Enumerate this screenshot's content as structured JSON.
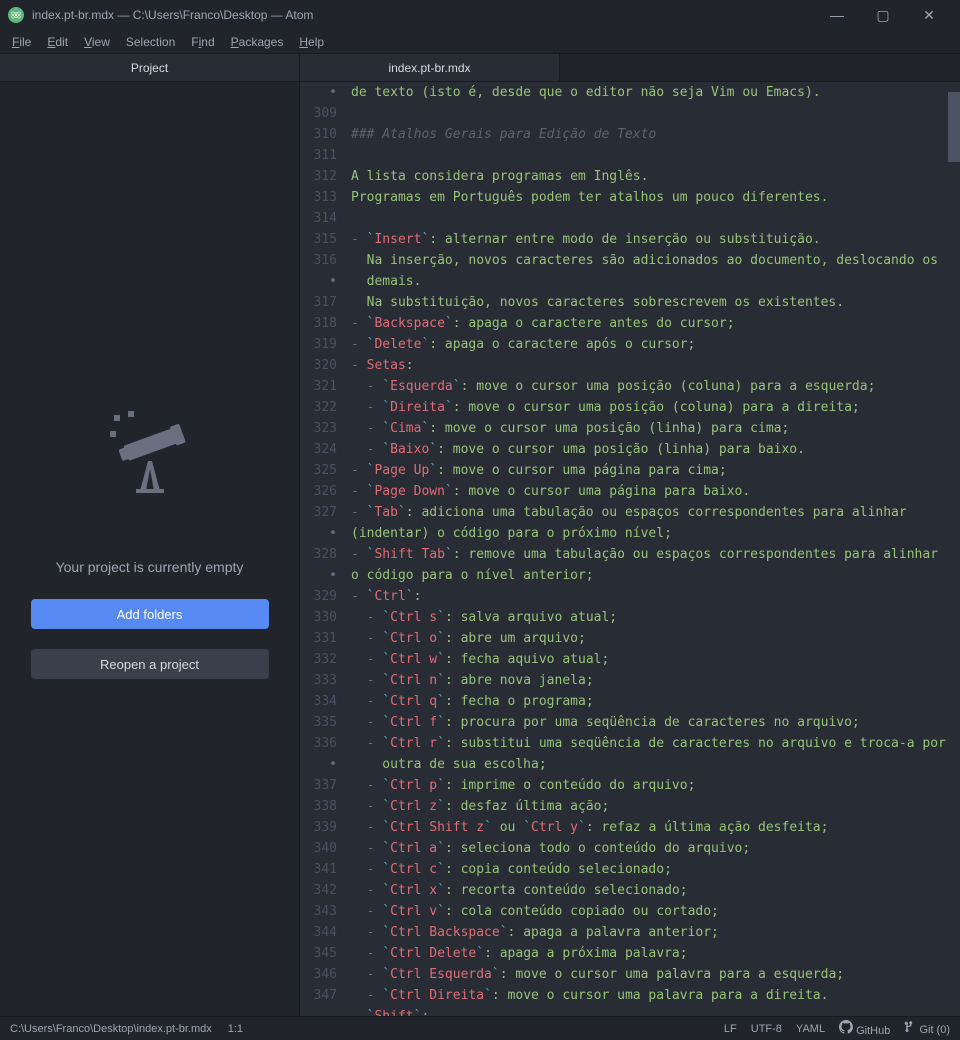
{
  "titlebar": {
    "title": "index.pt-br.mdx — C:\\Users\\Franco\\Desktop — Atom"
  },
  "menu": {
    "file": "File",
    "edit": "Edit",
    "view": "View",
    "selection": "Selection",
    "find": "Find",
    "packages": "Packages",
    "help": "Help"
  },
  "sidebar": {
    "tab_label": "Project",
    "empty_msg": "Your project is currently empty",
    "add_folders": "Add folders",
    "reopen": "Reopen a project"
  },
  "editor": {
    "tab_label": "index.pt-br.mdx",
    "lines": [
      {
        "num": "•",
        "tokens": [
          {
            "t": "de texto (isto é, desde que o editor não seja Vim ou Emacs).",
            "c": "green"
          }
        ]
      },
      {
        "num": "309",
        "tokens": []
      },
      {
        "num": "310",
        "tokens": [
          {
            "t": "### Atalhos Gerais para Edição de Texto",
            "c": "comment"
          }
        ]
      },
      {
        "num": "311",
        "tokens": []
      },
      {
        "num": "312",
        "tokens": [
          {
            "t": "A lista considera programas em Inglês.",
            "c": "green"
          }
        ]
      },
      {
        "num": "313",
        "tokens": [
          {
            "t": "Programas em Português podem ter atalhos um pouco diferentes.",
            "c": "green"
          }
        ]
      },
      {
        "num": "314",
        "tokens": []
      },
      {
        "num": "315",
        "tokens": [
          {
            "t": "- ",
            "c": "bullet"
          },
          {
            "t": "`",
            "c": "punct"
          },
          {
            "t": "Insert",
            "c": "red"
          },
          {
            "t": "`",
            "c": "punct"
          },
          {
            "t": ": alternar entre modo de inserção ou substituição.",
            "c": "green"
          }
        ]
      },
      {
        "num": "316",
        "tokens": [
          {
            "t": "  Na inserção, novos caracteres são adicionados ao documento, deslocando os",
            "c": "green"
          }
        ]
      },
      {
        "num": "•",
        "tokens": [
          {
            "t": "  demais.",
            "c": "green"
          }
        ]
      },
      {
        "num": "317",
        "tokens": [
          {
            "t": "  Na substituição, novos caracteres sobrescrevem os existentes.",
            "c": "green"
          }
        ]
      },
      {
        "num": "318",
        "tokens": [
          {
            "t": "- ",
            "c": "bullet"
          },
          {
            "t": "`",
            "c": "punct"
          },
          {
            "t": "Backspace",
            "c": "red"
          },
          {
            "t": "`",
            "c": "punct"
          },
          {
            "t": ": apaga o caractere antes do cursor;",
            "c": "green"
          }
        ]
      },
      {
        "num": "319",
        "tokens": [
          {
            "t": "- ",
            "c": "bullet"
          },
          {
            "t": "`",
            "c": "punct"
          },
          {
            "t": "Delete",
            "c": "red"
          },
          {
            "t": "`",
            "c": "punct"
          },
          {
            "t": ": apaga o caractere após o cursor;",
            "c": "green"
          }
        ]
      },
      {
        "num": "320",
        "tokens": [
          {
            "t": "- ",
            "c": "bullet"
          },
          {
            "t": "Setas",
            "c": "red"
          },
          {
            "t": ":",
            "c": "green"
          }
        ]
      },
      {
        "num": "321",
        "tokens": [
          {
            "t": "  - ",
            "c": "bullet"
          },
          {
            "t": "`",
            "c": "punct"
          },
          {
            "t": "Esquerda",
            "c": "red"
          },
          {
            "t": "`",
            "c": "punct"
          },
          {
            "t": ": move o cursor uma posição (coluna) para a esquerda;",
            "c": "green"
          }
        ]
      },
      {
        "num": "322",
        "tokens": [
          {
            "t": "  - ",
            "c": "bullet"
          },
          {
            "t": "`",
            "c": "punct"
          },
          {
            "t": "Direita",
            "c": "red"
          },
          {
            "t": "`",
            "c": "punct"
          },
          {
            "t": ": move o cursor uma posição (coluna) para a direita;",
            "c": "green"
          }
        ]
      },
      {
        "num": "323",
        "tokens": [
          {
            "t": "  - ",
            "c": "bullet"
          },
          {
            "t": "`",
            "c": "punct"
          },
          {
            "t": "Cima",
            "c": "red"
          },
          {
            "t": "`",
            "c": "punct"
          },
          {
            "t": ": move o cursor uma posição (linha) para cima;",
            "c": "green"
          }
        ]
      },
      {
        "num": "324",
        "tokens": [
          {
            "t": "  - ",
            "c": "bullet"
          },
          {
            "t": "`",
            "c": "punct"
          },
          {
            "t": "Baixo",
            "c": "red"
          },
          {
            "t": "`",
            "c": "punct"
          },
          {
            "t": ": move o cursor uma posição (linha) para baixo.",
            "c": "green"
          }
        ]
      },
      {
        "num": "325",
        "tokens": [
          {
            "t": "- ",
            "c": "bullet"
          },
          {
            "t": "`",
            "c": "punct"
          },
          {
            "t": "Page Up",
            "c": "red"
          },
          {
            "t": "`",
            "c": "punct"
          },
          {
            "t": ": move o cursor uma página para cima;",
            "c": "green"
          }
        ]
      },
      {
        "num": "326",
        "tokens": [
          {
            "t": "- ",
            "c": "bullet"
          },
          {
            "t": "`",
            "c": "punct"
          },
          {
            "t": "Page Down",
            "c": "red"
          },
          {
            "t": "`",
            "c": "punct"
          },
          {
            "t": ": move o cursor uma página para baixo.",
            "c": "green"
          }
        ]
      },
      {
        "num": "327",
        "tokens": [
          {
            "t": "- ",
            "c": "bullet"
          },
          {
            "t": "`",
            "c": "punct"
          },
          {
            "t": "Tab",
            "c": "red"
          },
          {
            "t": "`",
            "c": "punct"
          },
          {
            "t": ": adiciona uma tabulação ou espaços correspondentes para alinhar",
            "c": "green"
          }
        ]
      },
      {
        "num": "•",
        "tokens": [
          {
            "t": "(indentar) o código para o próximo nível;",
            "c": "green"
          }
        ]
      },
      {
        "num": "328",
        "tokens": [
          {
            "t": "- ",
            "c": "bullet"
          },
          {
            "t": "`",
            "c": "punct"
          },
          {
            "t": "Shift Tab",
            "c": "red"
          },
          {
            "t": "`",
            "c": "punct"
          },
          {
            "t": ": remove uma tabulação ou espaços correspondentes para alinhar",
            "c": "green"
          }
        ]
      },
      {
        "num": "•",
        "tokens": [
          {
            "t": "o código para o nível anterior;",
            "c": "green"
          }
        ]
      },
      {
        "num": "329",
        "tokens": [
          {
            "t": "- ",
            "c": "bullet"
          },
          {
            "t": "`",
            "c": "punct"
          },
          {
            "t": "Ctrl",
            "c": "red"
          },
          {
            "t": "`",
            "c": "punct"
          },
          {
            "t": ":",
            "c": "green"
          }
        ]
      },
      {
        "num": "330",
        "tokens": [
          {
            "t": "  - ",
            "c": "bullet"
          },
          {
            "t": "`",
            "c": "punct"
          },
          {
            "t": "Ctrl s",
            "c": "red"
          },
          {
            "t": "`",
            "c": "punct"
          },
          {
            "t": ": salva arquivo atual;",
            "c": "green"
          }
        ]
      },
      {
        "num": "331",
        "tokens": [
          {
            "t": "  - ",
            "c": "bullet"
          },
          {
            "t": "`",
            "c": "punct"
          },
          {
            "t": "Ctrl o",
            "c": "red"
          },
          {
            "t": "`",
            "c": "punct"
          },
          {
            "t": ": abre um arquivo;",
            "c": "green"
          }
        ]
      },
      {
        "num": "332",
        "tokens": [
          {
            "t": "  - ",
            "c": "bullet"
          },
          {
            "t": "`",
            "c": "punct"
          },
          {
            "t": "Ctrl w",
            "c": "red"
          },
          {
            "t": "`",
            "c": "punct"
          },
          {
            "t": ": fecha aquivo atual;",
            "c": "green"
          }
        ]
      },
      {
        "num": "333",
        "tokens": [
          {
            "t": "  - ",
            "c": "bullet"
          },
          {
            "t": "`",
            "c": "punct"
          },
          {
            "t": "Ctrl n",
            "c": "red"
          },
          {
            "t": "`",
            "c": "punct"
          },
          {
            "t": ": abre nova janela;",
            "c": "green"
          }
        ]
      },
      {
        "num": "334",
        "tokens": [
          {
            "t": "  - ",
            "c": "bullet"
          },
          {
            "t": "`",
            "c": "punct"
          },
          {
            "t": "Ctrl q",
            "c": "red"
          },
          {
            "t": "`",
            "c": "punct"
          },
          {
            "t": ": fecha o programa;",
            "c": "green"
          }
        ]
      },
      {
        "num": "335",
        "tokens": [
          {
            "t": "  - ",
            "c": "bullet"
          },
          {
            "t": "`",
            "c": "punct"
          },
          {
            "t": "Ctrl f",
            "c": "red"
          },
          {
            "t": "`",
            "c": "punct"
          },
          {
            "t": ": procura por uma seqüência de caracteres no arquivo;",
            "c": "green"
          }
        ]
      },
      {
        "num": "336",
        "tokens": [
          {
            "t": "  - ",
            "c": "bullet"
          },
          {
            "t": "`",
            "c": "punct"
          },
          {
            "t": "Ctrl r",
            "c": "red"
          },
          {
            "t": "`",
            "c": "punct"
          },
          {
            "t": ": substitui uma seqüência de caracteres no arquivo e troca-a por",
            "c": "green"
          }
        ]
      },
      {
        "num": "•",
        "tokens": [
          {
            "t": "    outra de sua escolha;",
            "c": "green"
          }
        ]
      },
      {
        "num": "337",
        "tokens": [
          {
            "t": "  - ",
            "c": "bullet"
          },
          {
            "t": "`",
            "c": "punct"
          },
          {
            "t": "Ctrl p",
            "c": "red"
          },
          {
            "t": "`",
            "c": "punct"
          },
          {
            "t": ": imprime o conteúdo do arquivo;",
            "c": "green"
          }
        ]
      },
      {
        "num": "338",
        "tokens": [
          {
            "t": "  - ",
            "c": "bullet"
          },
          {
            "t": "`",
            "c": "punct"
          },
          {
            "t": "Ctrl z",
            "c": "red"
          },
          {
            "t": "`",
            "c": "punct"
          },
          {
            "t": ": desfaz última ação;",
            "c": "green"
          }
        ]
      },
      {
        "num": "339",
        "tokens": [
          {
            "t": "  - ",
            "c": "bullet"
          },
          {
            "t": "`",
            "c": "punct"
          },
          {
            "t": "Ctrl Shift z",
            "c": "red"
          },
          {
            "t": "`",
            "c": "punct"
          },
          {
            "t": " ou ",
            "c": "green"
          },
          {
            "t": "`",
            "c": "punct"
          },
          {
            "t": "Ctrl y",
            "c": "red"
          },
          {
            "t": "`",
            "c": "punct"
          },
          {
            "t": ": refaz a última ação desfeita;",
            "c": "green"
          }
        ]
      },
      {
        "num": "340",
        "tokens": [
          {
            "t": "  - ",
            "c": "bullet"
          },
          {
            "t": "`",
            "c": "punct"
          },
          {
            "t": "Ctrl a",
            "c": "red"
          },
          {
            "t": "`",
            "c": "punct"
          },
          {
            "t": ": seleciona todo o conteúdo do arquivo;",
            "c": "green"
          }
        ]
      },
      {
        "num": "341",
        "tokens": [
          {
            "t": "  - ",
            "c": "bullet"
          },
          {
            "t": "`",
            "c": "punct"
          },
          {
            "t": "Ctrl c",
            "c": "red"
          },
          {
            "t": "`",
            "c": "punct"
          },
          {
            "t": ": copia conteúdo selecionado;",
            "c": "green"
          }
        ]
      },
      {
        "num": "342",
        "tokens": [
          {
            "t": "  - ",
            "c": "bullet"
          },
          {
            "t": "`",
            "c": "punct"
          },
          {
            "t": "Ctrl x",
            "c": "red"
          },
          {
            "t": "`",
            "c": "punct"
          },
          {
            "t": ": recorta conteúdo selecionado;",
            "c": "green"
          }
        ]
      },
      {
        "num": "343",
        "tokens": [
          {
            "t": "  - ",
            "c": "bullet"
          },
          {
            "t": "`",
            "c": "punct"
          },
          {
            "t": "Ctrl v",
            "c": "red"
          },
          {
            "t": "`",
            "c": "punct"
          },
          {
            "t": ": cola conteúdo copiado ou cortado;",
            "c": "green"
          }
        ]
      },
      {
        "num": "344",
        "tokens": [
          {
            "t": "  - ",
            "c": "bullet"
          },
          {
            "t": "`",
            "c": "punct"
          },
          {
            "t": "Ctrl Backspace",
            "c": "red"
          },
          {
            "t": "`",
            "c": "punct"
          },
          {
            "t": ": apaga a palavra anterior;",
            "c": "green"
          }
        ]
      },
      {
        "num": "345",
        "tokens": [
          {
            "t": "  - ",
            "c": "bullet"
          },
          {
            "t": "`",
            "c": "punct"
          },
          {
            "t": "Ctrl Delete",
            "c": "red"
          },
          {
            "t": "`",
            "c": "punct"
          },
          {
            "t": ": apaga a próxima palavra;",
            "c": "green"
          }
        ]
      },
      {
        "num": "346",
        "tokens": [
          {
            "t": "  - ",
            "c": "bullet"
          },
          {
            "t": "`",
            "c": "punct"
          },
          {
            "t": "Ctrl Esquerda",
            "c": "red"
          },
          {
            "t": "`",
            "c": "punct"
          },
          {
            "t": ": move o cursor uma palavra para a esquerda;",
            "c": "green"
          }
        ]
      },
      {
        "num": "347",
        "tokens": [
          {
            "t": "  - ",
            "c": "bullet"
          },
          {
            "t": "`",
            "c": "punct"
          },
          {
            "t": "Ctrl Direita",
            "c": "red"
          },
          {
            "t": "`",
            "c": "punct"
          },
          {
            "t": ": move o cursor uma palavra para a direita.",
            "c": "green"
          }
        ]
      },
      {
        "num": "",
        "tokens": [
          {
            "t": "  `",
            "c": "punct"
          },
          {
            "t": "Shift",
            "c": "red"
          },
          {
            "t": "`:",
            "c": "punct"
          }
        ]
      }
    ]
  },
  "statusbar": {
    "path": "C:\\Users\\Franco\\Desktop\\index.pt-br.mdx",
    "cursor": "1:1",
    "line_ending": "LF",
    "encoding": "UTF-8",
    "grammar": "YAML",
    "github": "GitHub",
    "git": "Git (0)"
  }
}
